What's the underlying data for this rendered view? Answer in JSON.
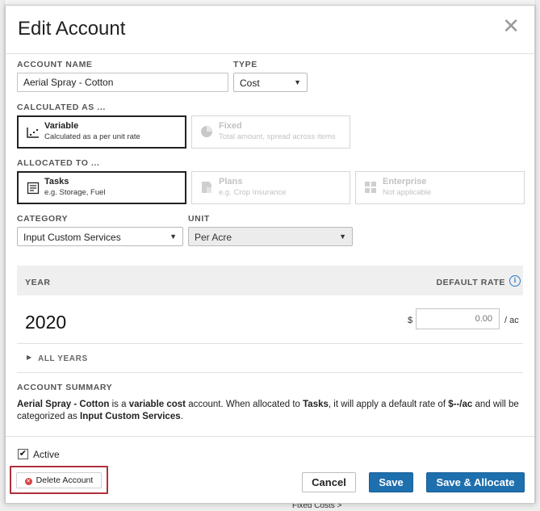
{
  "background": {
    "bottom_text": "Fixed Costs >"
  },
  "modal": {
    "title": "Edit Account",
    "close_glyph": "✕"
  },
  "account_name": {
    "label": "ACCOUNT NAME",
    "value": "Aerial Spray - Cotton"
  },
  "type": {
    "label": "TYPE",
    "value": "Cost"
  },
  "calculated_as": {
    "label": "CALCULATED AS ...",
    "options": [
      {
        "title": "Variable",
        "subtitle": "Calculated as a per unit rate",
        "selected": true,
        "icon": "scatter-chart-icon"
      },
      {
        "title": "Fixed",
        "subtitle": "Total amount, spread across items",
        "selected": false,
        "icon": "pie-chart-icon"
      }
    ]
  },
  "allocated_to": {
    "label": "ALLOCATED TO ...",
    "options": [
      {
        "title": "Tasks",
        "subtitle": "e.g. Storage, Fuel",
        "selected": true,
        "icon": "task-list-icon"
      },
      {
        "title": "Plans",
        "subtitle": "e.g. Crop Insurance",
        "selected": false,
        "icon": "plans-icon"
      },
      {
        "title": "Enterprise",
        "subtitle": "Not applicable",
        "selected": false,
        "icon": "grid-icon"
      }
    ]
  },
  "category": {
    "label": "CATEGORY",
    "value": "Input Custom Services"
  },
  "unit": {
    "label": "UNIT",
    "value": "Per Acre"
  },
  "rates": {
    "year_header": "YEAR",
    "rate_header": "DEFAULT RATE",
    "year": "2020",
    "currency": "$",
    "placeholder": "0.00",
    "per_unit": "/ ac",
    "all_years_label": "ALL YEARS"
  },
  "summary": {
    "label": "ACCOUNT SUMMARY",
    "name": "Aerial Spray - Cotton",
    "text_is_a": " is a ",
    "cost_kind": "variable cost",
    "text_account": " account. When allocated to ",
    "target": "Tasks",
    "text_rate": ", it will apply a default rate of ",
    "rate": "$--/ac",
    "text_categorized": " and will be categorized as ",
    "category": "Input Custom Services",
    "text_end": "."
  },
  "active": {
    "label": "Active",
    "checked": true
  },
  "buttons": {
    "delete": "Delete Account",
    "cancel": "Cancel",
    "save": "Save",
    "save_allocate": "Save & Allocate"
  },
  "colors": {
    "primary": "#1e6fae",
    "highlight": "#b03039",
    "delete_icon": "#d34444"
  }
}
